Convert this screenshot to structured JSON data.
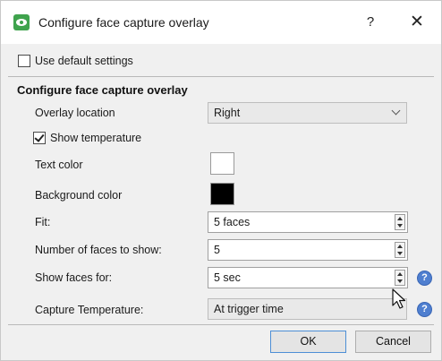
{
  "window": {
    "title": "Configure face capture overlay",
    "help": "?",
    "close": "✕"
  },
  "use_default": {
    "label": "Use default settings",
    "checked": false
  },
  "group": {
    "title": "Configure face capture overlay",
    "overlay_location": {
      "label": "Overlay location",
      "value": "Right"
    },
    "show_temperature": {
      "label": "Show temperature",
      "checked": true
    },
    "text_color": {
      "label": "Text color",
      "color": "#ffffff"
    },
    "background_color": {
      "label": "Background color",
      "color": "#000000"
    },
    "fit": {
      "label": "Fit:",
      "value": "5 faces"
    },
    "faces_to_show": {
      "label": "Number of faces to show:",
      "value": "5"
    },
    "show_faces_for": {
      "label": "Show faces for:",
      "value": "5 sec"
    },
    "capture_temperature": {
      "label": "Capture Temperature:",
      "value": "At trigger time"
    }
  },
  "info_icon": "?",
  "buttons": {
    "ok": "OK",
    "cancel": "Cancel"
  },
  "colors": {
    "accent": "#4f7fd0",
    "app_icon": "#3fa34d",
    "dialog_bg": "#f0f0f0"
  }
}
